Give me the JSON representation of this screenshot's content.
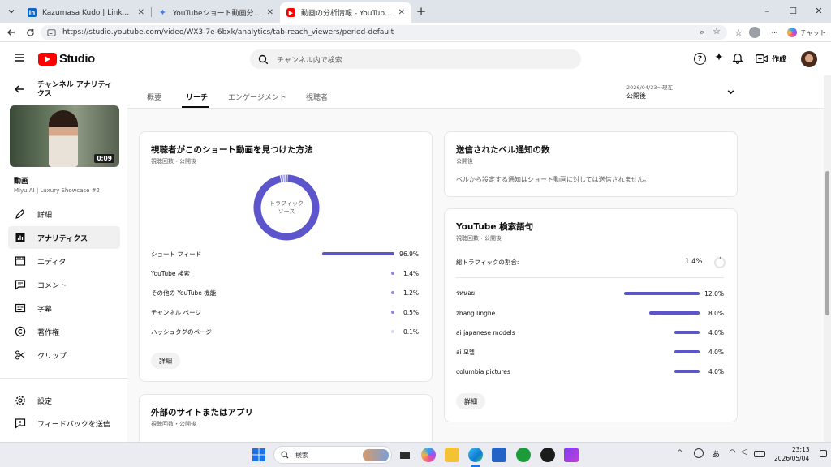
{
  "browser": {
    "tabs": [
      {
        "title": "Kazumasa Kudo | LinkedIn",
        "favicon": "linkedin-icon"
      },
      {
        "title": "YouTubeショート動画分析と改善提案",
        "favicon": "gemini-icon"
      },
      {
        "title": "動画の分析情報 - YouTube Studio",
        "favicon": "youtube-icon",
        "active": true
      }
    ],
    "url": "https://studio.youtube.com/video/WX3-7e-6bxk/analytics/tab-reach_viewers/period-default",
    "chat_label": "チャット"
  },
  "header": {
    "logo_text": "Studio",
    "search_placeholder": "チャンネル内で検索",
    "create_label": "作成"
  },
  "sidebar": {
    "title": "チャンネル アナリティクス",
    "video_duration": "0:09",
    "video_label": "動画",
    "video_title": "Miyu AI | Luxury Showcase #2",
    "items": [
      {
        "label": "詳細",
        "icon": "pencil-icon"
      },
      {
        "label": "アナリティクス",
        "icon": "analytics-icon",
        "active": true
      },
      {
        "label": "エディタ",
        "icon": "editor-icon"
      },
      {
        "label": "コメント",
        "icon": "comment-icon"
      },
      {
        "label": "字幕",
        "icon": "subtitles-icon"
      },
      {
        "label": "著作権",
        "icon": "copyright-icon"
      },
      {
        "label": "クリップ",
        "icon": "scissors-icon"
      }
    ],
    "footer": [
      {
        "label": "設定",
        "icon": "gear-icon"
      },
      {
        "label": "フィードバックを送信",
        "icon": "feedback-icon"
      }
    ]
  },
  "subtabs": [
    "概要",
    "リーチ",
    "エンゲージメント",
    "視聴者"
  ],
  "period": {
    "range": "2026/04/23～現在",
    "label": "公開後"
  },
  "traffic_card": {
    "title": "視聴者がこのショート動画を見つけた方法",
    "subtitle": "視聴回数・公開後",
    "donut_label": "トラフィック ソース",
    "rows": [
      {
        "label": "ショート フィード",
        "value": "96.9%",
        "frac": 0.969
      },
      {
        "label": "YouTube 検索",
        "value": "1.4%",
        "frac": 0.014
      },
      {
        "label": "その他の YouTube 機能",
        "value": "1.2%",
        "frac": 0.012
      },
      {
        "label": "チャンネル ページ",
        "value": "0.5%",
        "frac": 0.005
      },
      {
        "label": "ハッシュタグのページ",
        "value": "0.1%",
        "frac": 0.001
      }
    ],
    "button": "詳細"
  },
  "bell_card": {
    "title": "送信されたベル通知の数",
    "subtitle": "公開後",
    "message": "ベルから設定する通知はショート動画に対しては送信されません。"
  },
  "search_card": {
    "title": "YouTube 検索語句",
    "subtitle": "視聴回数・公開後",
    "total_label": "総トラフィックの割合:",
    "total_value": "1.4%",
    "rows": [
      {
        "label": "รหนอย",
        "value": "12.0%",
        "frac": 0.12
      },
      {
        "label": "zhang linghe",
        "value": "8.0%",
        "frac": 0.08
      },
      {
        "label": "ai japanese models",
        "value": "4.0%",
        "frac": 0.04
      },
      {
        "label": "ai 모델",
        "value": "4.0%",
        "frac": 0.04
      },
      {
        "label": "columbia pictures",
        "value": "4.0%",
        "frac": 0.04
      }
    ],
    "button": "詳細"
  },
  "external_card": {
    "title": "外部のサイトまたはアプリ",
    "subtitle": "視聴回数・公開後"
  },
  "taskbar": {
    "search_label": "検索",
    "ime": "あ",
    "time": "23:13",
    "date": "2026/05/04"
  },
  "colors": {
    "accent": "#5c55cc",
    "youtube_red": "#ff0000"
  }
}
